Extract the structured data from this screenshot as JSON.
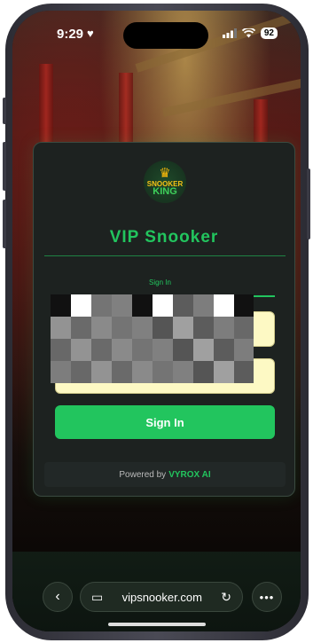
{
  "status": {
    "time": "9:29",
    "battery": "92"
  },
  "card": {
    "logo": {
      "line1": "SNOOKER",
      "line2": "KING"
    },
    "title": "VIP Snooker",
    "tab": "Sign In",
    "password_value": "••••••••",
    "sign_in_label": "Sign In",
    "footer_prefix": "Powered by",
    "footer_brand": "VYROX AI"
  },
  "browser": {
    "url": "vipsnooker.com"
  },
  "colors": {
    "accent": "#22c55e",
    "input_bg": "#fdf9c4",
    "card_bg": "#1d2220"
  },
  "icons": {
    "heart": "heart-icon",
    "signal": "signal-icon",
    "wifi": "wifi-icon",
    "back": "chevron-left-icon",
    "tabs": "tabs-icon",
    "reload": "reload-icon",
    "more": "more-icon",
    "crown": "crown-icon"
  }
}
